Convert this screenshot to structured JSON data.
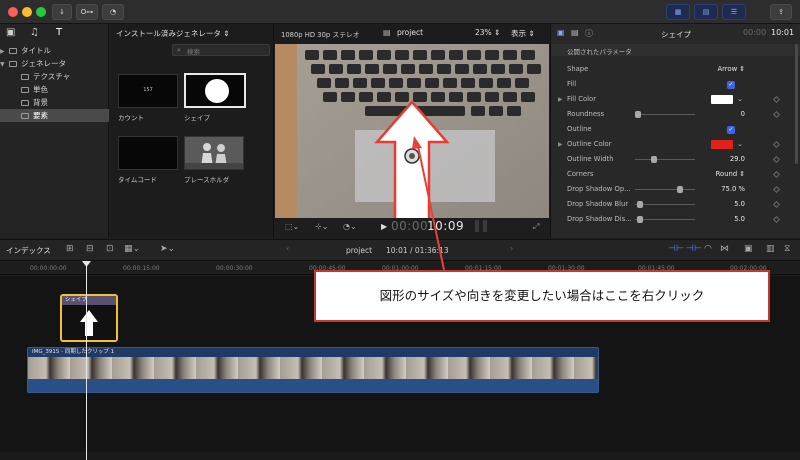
{
  "toolbar": {
    "key_button": "O⊶",
    "colors": {
      "close": "#fc5f57",
      "minimize": "#fdbc2e",
      "maximize": "#28c840",
      "accent": "#3b64e6"
    }
  },
  "sidebar": {
    "items": [
      {
        "label": "タイトル",
        "expander": "▶"
      },
      {
        "label": "ジェネレータ",
        "expander": "▼"
      },
      {
        "label": "テクスチャ",
        "expander": ""
      },
      {
        "label": "単色",
        "expander": ""
      },
      {
        "label": "背景",
        "expander": ""
      },
      {
        "label": "要素",
        "expander": ""
      }
    ]
  },
  "browser": {
    "title": "インストール済みジェネレータ ⇕",
    "search_placeholder": "検索",
    "items": [
      {
        "label": "カウント",
        "thumb_text": "157"
      },
      {
        "label": "シェイプ",
        "thumb_text": ""
      },
      {
        "label": "タイムコード",
        "thumb_text": ""
      },
      {
        "label": "プレースホルダ",
        "thumb_text": ""
      }
    ]
  },
  "viewer": {
    "format": "1080p HD 30p ステレオ",
    "project": "project",
    "zoom": "23%",
    "display_menu": "表示",
    "timecode_dim": "00:00",
    "timecode": "10:09"
  },
  "inspector": {
    "title": "シェイプ",
    "timecode_dim": "00:00",
    "timecode": "10:01",
    "section": "公開されたパラメータ",
    "rows": [
      {
        "label": "Shape",
        "value": "Arrow ⇕"
      },
      {
        "label": "Fill",
        "value": "✓"
      },
      {
        "label": "Fill Color",
        "value": "",
        "swatch": "#ffffff"
      },
      {
        "label": "Roundness",
        "value": "0"
      },
      {
        "label": "Outline",
        "value": "✓"
      },
      {
        "label": "Outline Color",
        "value": "",
        "swatch": "#e0221a"
      },
      {
        "label": "Outline Width",
        "value": "29.0"
      },
      {
        "label": "Corners",
        "value": "Round ⇕"
      },
      {
        "label": "Drop Shadow Op...",
        "value": "75.0  %"
      },
      {
        "label": "Drop Shadow Blur",
        "value": "5.0"
      },
      {
        "label": "Drop Shadow Dis...",
        "value": "5.0"
      }
    ]
  },
  "timeline": {
    "index_label": "インデックス",
    "project": "project",
    "duration": "10:01 / 01:36:13",
    "ticks": [
      "00:00:00:00",
      "00:00:15:00",
      "00:00:30:00",
      "00:00:45:00",
      "00:01:00:00",
      "00:01:15:00",
      "00:01:30:00",
      "00:01:45:00",
      "00:02:00:00"
    ],
    "shape_clip_label": "シェイプ",
    "video_clip_label": "IMG_3915 - 同期したクリップ 1"
  },
  "callout": {
    "text": "図形のサイズや向きを変更したい場合はここを右クリック"
  }
}
